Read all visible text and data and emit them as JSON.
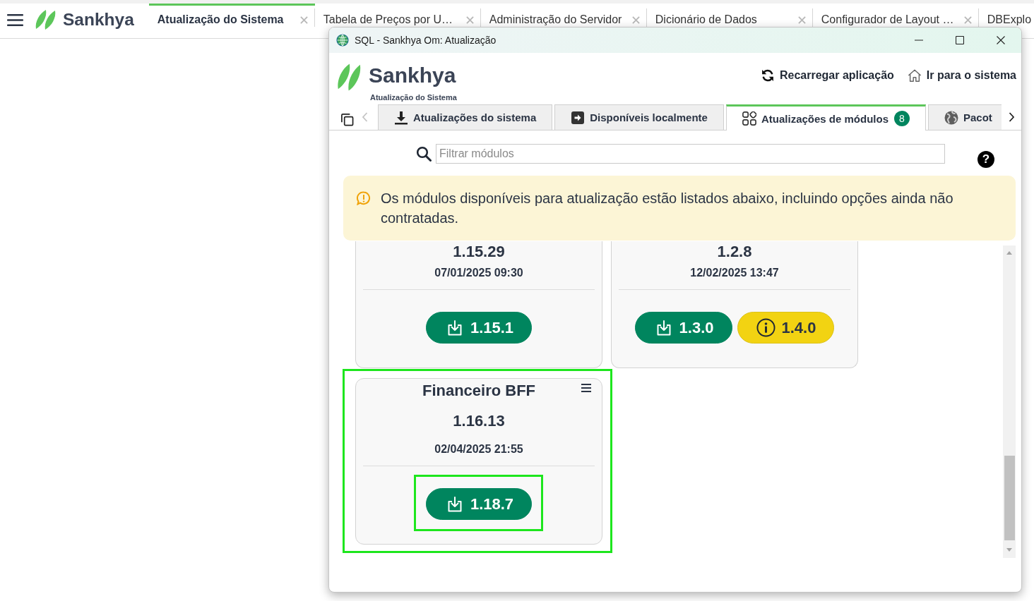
{
  "app_bar": {
    "logo": "Sankhya",
    "tabs": [
      {
        "label": "Atualização do Sistema",
        "selected": true,
        "closable": true
      },
      {
        "label": "Tabela de Preços por U…",
        "selected": false,
        "closable": true
      },
      {
        "label": "Administração do Servidor",
        "selected": false,
        "closable": true
      },
      {
        "label": "Dicionário de Dados",
        "selected": false,
        "closable": true
      },
      {
        "label": "Configurador de Layout …",
        "selected": false,
        "closable": true
      },
      {
        "label": "DBExplo",
        "selected": false,
        "closable": false
      }
    ]
  },
  "window": {
    "title": "SQL - Sankhya Om: Atualização",
    "logo": "Sankhya",
    "subtitle": "Atualização do Sistema",
    "actions": [
      "Recarregar aplicação",
      "Ir para o sistema"
    ],
    "tabs": [
      {
        "label": "Atualizações do sistema",
        "selected": false
      },
      {
        "label": "Disponíveis localmente",
        "selected": false
      },
      {
        "label": "Atualizações de módulos",
        "selected": true,
        "badge": "8"
      },
      {
        "label": "Pacot",
        "selected": false
      }
    ],
    "search": {
      "placeholder": "Filtrar módulos"
    },
    "help": "?",
    "alert": "Os módulos disponíveis para atualização estão listados abaixo, incluindo opções ainda não contratadas.",
    "cards": [
      {
        "version": "1.15.29",
        "date": "07/01/2025 09:30",
        "highlighted": false,
        "updates": [
          {
            "label": "1.15.1",
            "kind": "download",
            "highlighted": false
          }
        ]
      },
      {
        "version": "1.2.8",
        "date": "12/02/2025 13:47",
        "highlighted": false,
        "updates": [
          {
            "label": "1.3.0",
            "kind": "download",
            "highlighted": false
          },
          {
            "label": "1.4.0",
            "kind": "info",
            "highlighted": false
          }
        ]
      },
      {
        "title": "Financeiro BFF",
        "version": "1.16.13",
        "date": "02/04/2025 21:55",
        "highlighted": true,
        "updates": [
          {
            "label": "1.18.7",
            "kind": "download",
            "highlighted": true
          }
        ]
      }
    ]
  }
}
